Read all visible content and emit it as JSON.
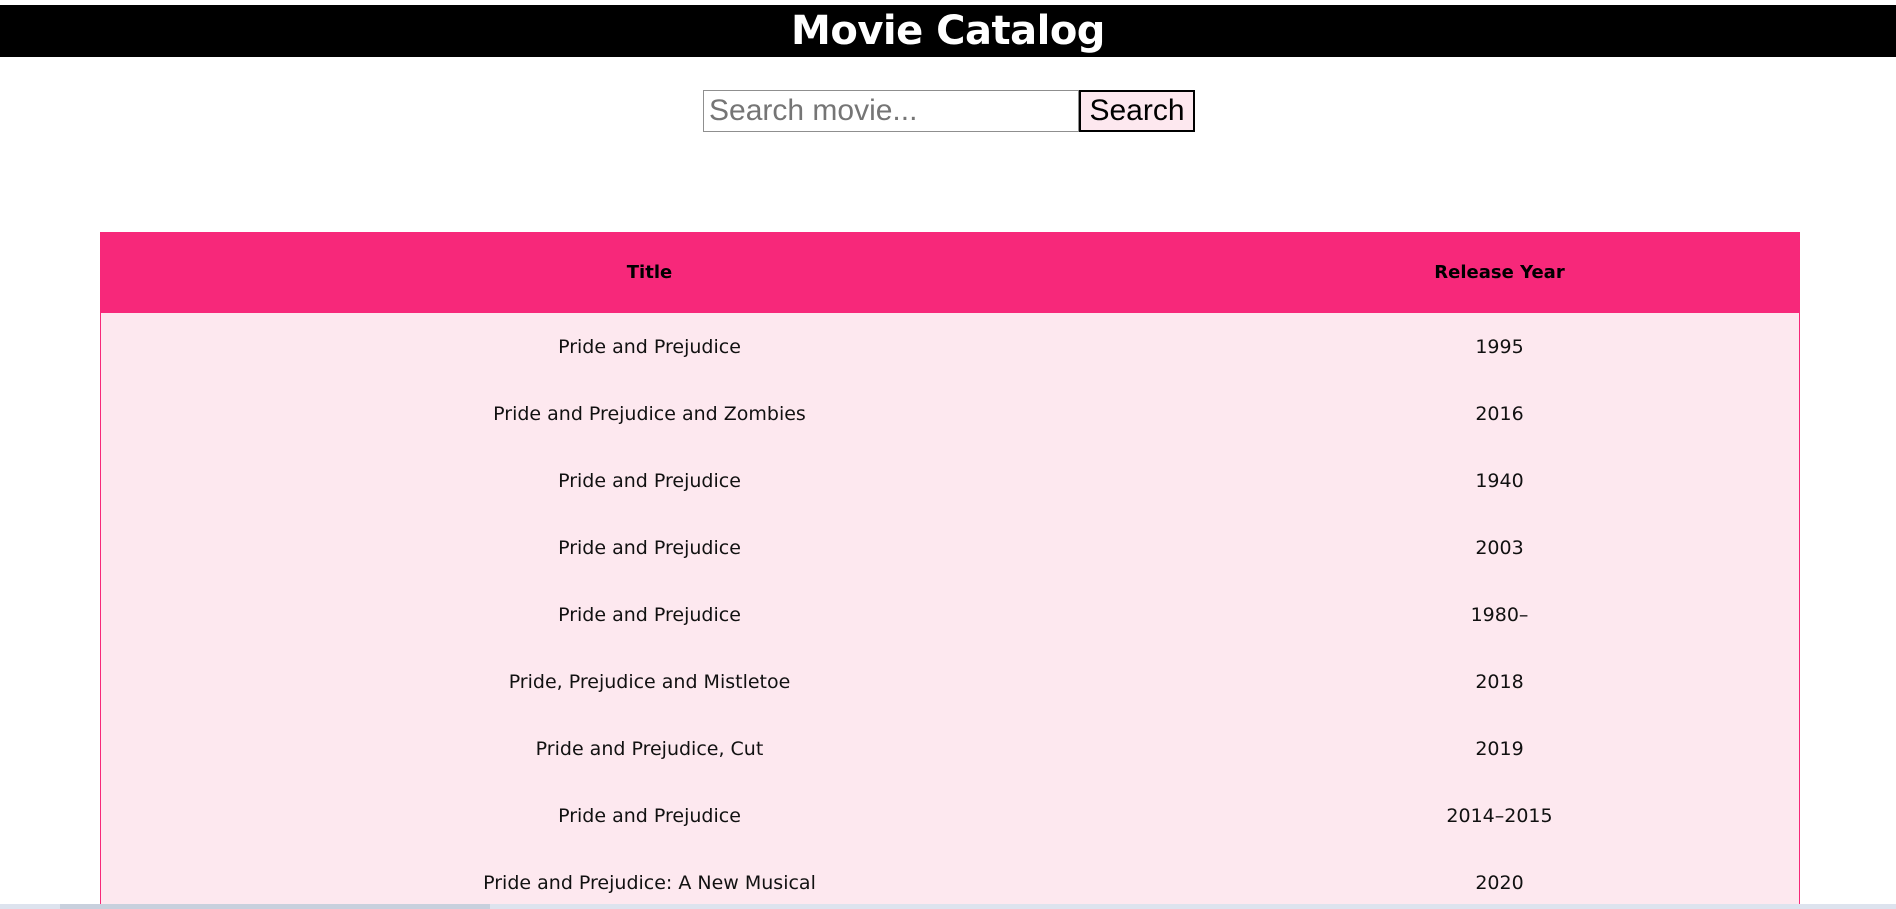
{
  "header": {
    "title": "Movie Catalog"
  },
  "search": {
    "placeholder": "Search movie...",
    "value": "",
    "button_label": "Search"
  },
  "table": {
    "columns": [
      "Title",
      "Release Year"
    ],
    "rows": [
      {
        "title": "Pride and Prejudice",
        "year": "1995"
      },
      {
        "title": "Pride and Prejudice and Zombies",
        "year": "2016"
      },
      {
        "title": "Pride and Prejudice",
        "year": "1940"
      },
      {
        "title": "Pride and Prejudice",
        "year": "2003"
      },
      {
        "title": "Pride and Prejudice",
        "year": "1980–"
      },
      {
        "title": "Pride, Prejudice and Mistletoe",
        "year": "2018"
      },
      {
        "title": "Pride and Prejudice, Cut",
        "year": "2019"
      },
      {
        "title": "Pride and Prejudice",
        "year": "2014–2015"
      },
      {
        "title": "Pride and Prejudice: A New Musical",
        "year": "2020"
      }
    ]
  },
  "colors": {
    "header_bar": "#000000",
    "table_header": "#f7287a",
    "table_body": "#fde8ef",
    "button_bg": "#fde8ef"
  }
}
